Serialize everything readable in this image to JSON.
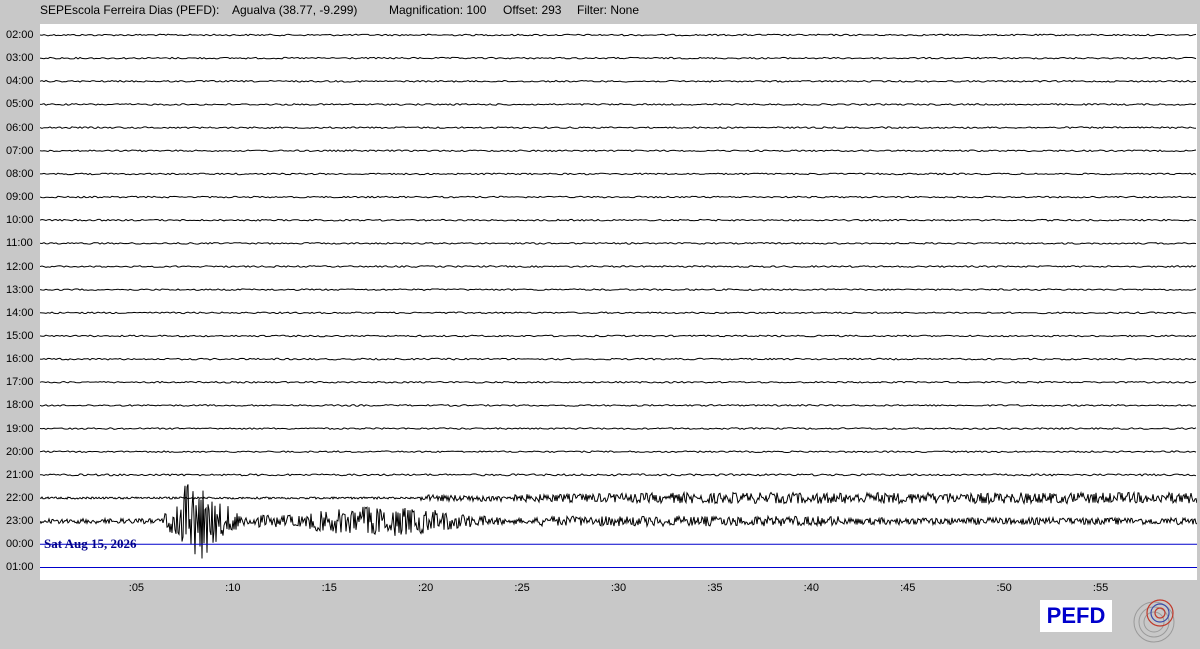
{
  "header": {
    "station": "SEPEscola Ferreira Dias (PEFD):",
    "location": "Agualva (38.77, -9.299)",
    "magnification": "Magnification: 100",
    "offset": "Offset: 293",
    "filter": "Filter: None"
  },
  "hours": [
    "02:00",
    "03:00",
    "04:00",
    "05:00",
    "06:00",
    "07:00",
    "08:00",
    "09:00",
    "10:00",
    "11:00",
    "12:00",
    "13:00",
    "14:00",
    "15:00",
    "16:00",
    "17:00",
    "18:00",
    "19:00",
    "20:00",
    "21:00",
    "22:00",
    "23:00",
    "00:00",
    "01:00"
  ],
  "minutes": [
    ":05",
    ":10",
    ":15",
    ":20",
    ":25",
    ":30",
    ":35",
    ":40",
    ":45",
    ":50",
    ":55"
  ],
  "minute_values": [
    5,
    10,
    15,
    20,
    25,
    30,
    35,
    40,
    45,
    50,
    55
  ],
  "date_label": "Sat Aug 15, 2026",
  "station_badge": "PEFD",
  "colors": {
    "trace": "#000000",
    "future_trace": "#0000cc",
    "date_text": "#00008b",
    "badge_text": "#0000cc",
    "background": "#c8c8c8",
    "plot_background": "#ffffff"
  },
  "icons": {
    "logo": "seismo-logo-icon"
  }
}
